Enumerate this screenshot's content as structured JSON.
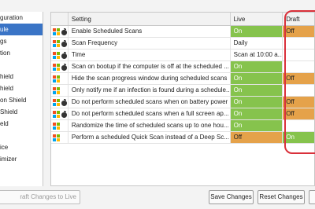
{
  "sidebar": {
    "items": [
      {
        "label": "guration",
        "selected": false
      },
      {
        "label": "ule",
        "selected": true
      },
      {
        "label": "gs",
        "selected": false
      },
      {
        "label": "tion",
        "selected": false
      },
      {
        "label": "",
        "selected": false
      },
      {
        "label": "hield",
        "selected": false
      },
      {
        "label": "hield",
        "selected": false
      },
      {
        "label": "on Shield",
        "selected": false
      },
      {
        "label": "Shield",
        "selected": false
      },
      {
        "label": "eld",
        "selected": false
      },
      {
        "label": "",
        "selected": false
      },
      {
        "label": "ice",
        "selected": false
      },
      {
        "label": "imizer",
        "selected": false
      }
    ]
  },
  "grid": {
    "headers": {
      "setting": "Setting",
      "live": "Live",
      "draft": "Draft"
    },
    "rows": [
      {
        "platforms": [
          "windows",
          "apple"
        ],
        "setting": "Enable Scheduled Scans",
        "live": "On",
        "live_style": "green",
        "draft": "Off",
        "draft_style": "orange"
      },
      {
        "platforms": [
          "windows",
          "apple"
        ],
        "setting": "Scan Frequency",
        "live": "Daily",
        "live_style": "",
        "draft": "",
        "draft_style": ""
      },
      {
        "platforms": [
          "windows",
          "apple"
        ],
        "setting": "Time",
        "live": "Scan at 10:00 a...",
        "live_style": "",
        "draft": "",
        "draft_style": ""
      },
      {
        "platforms": [
          "windows",
          "apple"
        ],
        "setting": "Scan on bootup if the computer is off at the scheduled ...",
        "live": "On",
        "live_style": "green",
        "draft": "",
        "draft_style": ""
      },
      {
        "platforms": [
          "windows"
        ],
        "setting": "Hide the scan progress window during scheduled scans",
        "live": "On",
        "live_style": "green",
        "draft": "Off",
        "draft_style": "orange"
      },
      {
        "platforms": [
          "windows"
        ],
        "setting": "Only notify me if an infection is found during a schedule...",
        "live": "On",
        "live_style": "green",
        "draft": "",
        "draft_style": ""
      },
      {
        "platforms": [
          "windows",
          "apple"
        ],
        "setting": "Do not perform scheduled scans when on battery power",
        "live": "On",
        "live_style": "green",
        "draft": "Off",
        "draft_style": "orange"
      },
      {
        "platforms": [
          "windows",
          "apple"
        ],
        "setting": "Do not perform scheduled scans when a full screen ap...",
        "live": "On",
        "live_style": "green",
        "draft": "Off",
        "draft_style": "orange"
      },
      {
        "platforms": [
          "windows"
        ],
        "setting": "Randomize the time of scheduled scans up to one hou...",
        "live": "On",
        "live_style": "green",
        "draft": "",
        "draft_style": ""
      },
      {
        "platforms": [
          "windows"
        ],
        "setting": "Perform a scheduled Quick Scan instead of a Deep Sc...",
        "live": "Off",
        "live_style": "orange",
        "draft": "On",
        "draft_style": "green"
      }
    ]
  },
  "buttons": {
    "publish": "raft Changes to Live",
    "save": "Save Changes",
    "reset": "Reset Changes",
    "extra": ""
  },
  "colors": {
    "on": "#86c34d",
    "off": "#e5a24a",
    "selection": "#3a74c6",
    "highlight": "#d9303a"
  }
}
